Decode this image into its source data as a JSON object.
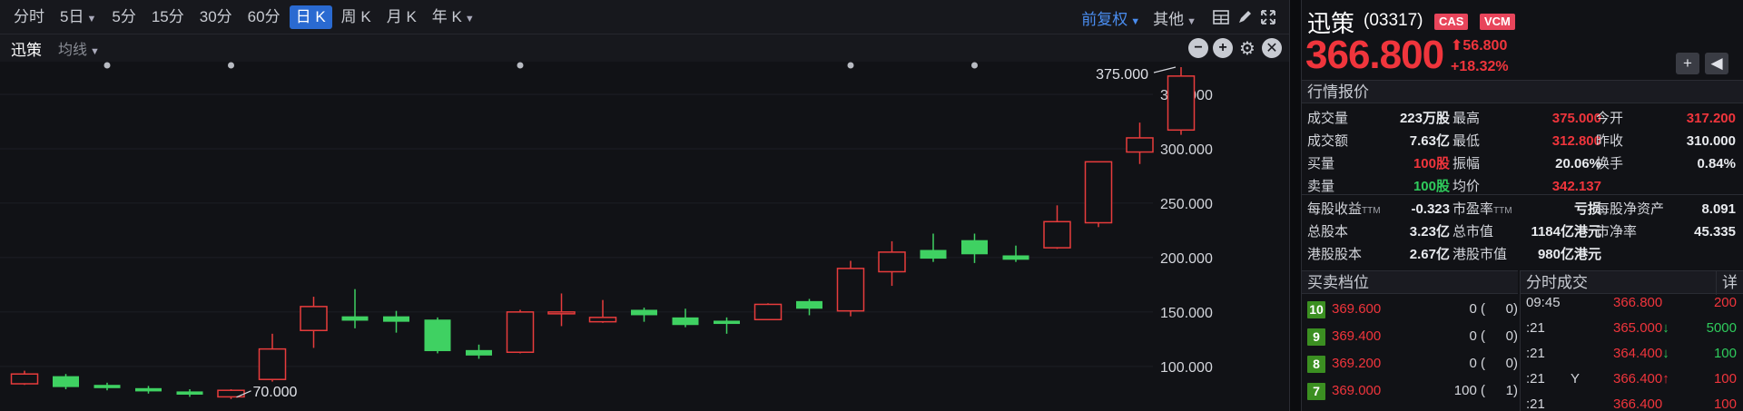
{
  "toolbar": {
    "periods": [
      {
        "label": "分时",
        "caret": false,
        "active": false
      },
      {
        "label": "5日",
        "caret": true,
        "active": false
      },
      {
        "label": "5分",
        "caret": false,
        "active": false
      },
      {
        "label": "15分",
        "caret": false,
        "active": false
      },
      {
        "label": "30分",
        "caret": false,
        "active": false
      },
      {
        "label": "60分",
        "caret": false,
        "active": false
      },
      {
        "label": "日 K",
        "caret": false,
        "active": true
      },
      {
        "label": "周 K",
        "caret": false,
        "active": false
      },
      {
        "label": "月 K",
        "caret": false,
        "active": false
      },
      {
        "label": "年 K",
        "caret": true,
        "active": false
      }
    ],
    "adjust_label": "前复权",
    "other_label": "其他"
  },
  "chart_header": {
    "name": "迅策",
    "ma_label": "均线"
  },
  "chart_data": {
    "type": "candlestick",
    "y_ticks": [
      "100.000",
      "150.000",
      "200.000",
      "250.000",
      "300.000",
      "350.000"
    ],
    "ylim": [
      64,
      380
    ],
    "up_color": "#e83c3c",
    "down_color": "#3fd162",
    "max_label": "375.000",
    "min_label": "70.000",
    "marker_candles": [
      2,
      5,
      12,
      20,
      23
    ],
    "candles": [
      {
        "o": 84,
        "c": 93,
        "h": 96,
        "l": 83
      },
      {
        "o": 91,
        "c": 81,
        "h": 93,
        "l": 79
      },
      {
        "o": 83,
        "c": 80,
        "h": 85,
        "l": 78
      },
      {
        "o": 80,
        "c": 77,
        "h": 82,
        "l": 75
      },
      {
        "o": 77,
        "c": 74,
        "h": 79,
        "l": 72
      },
      {
        "o": 72,
        "c": 78,
        "h": 79,
        "l": 70
      },
      {
        "o": 88,
        "c": 116,
        "h": 130,
        "l": 86
      },
      {
        "o": 133,
        "c": 155,
        "h": 164,
        "l": 117
      },
      {
        "o": 146,
        "c": 142,
        "h": 171,
        "l": 135
      },
      {
        "o": 146,
        "c": 141,
        "h": 151,
        "l": 131
      },
      {
        "o": 143,
        "c": 114,
        "h": 145,
        "l": 112
      },
      {
        "o": 115,
        "c": 110,
        "h": 120,
        "l": 107
      },
      {
        "o": 113,
        "c": 150,
        "h": 152,
        "l": 112
      },
      {
        "o": 150,
        "c": 150,
        "h": 167,
        "l": 137
      },
      {
        "o": 141,
        "c": 145,
        "h": 161,
        "l": 140
      },
      {
        "o": 152,
        "c": 147,
        "h": 154,
        "l": 141
      },
      {
        "o": 145,
        "c": 138,
        "h": 153,
        "l": 136
      },
      {
        "o": 142,
        "c": 139,
        "h": 145,
        "l": 130
      },
      {
        "o": 143,
        "c": 157,
        "h": 158,
        "l": 143
      },
      {
        "o": 160,
        "c": 153,
        "h": 162,
        "l": 147
      },
      {
        "o": 151,
        "c": 190,
        "h": 197,
        "l": 146
      },
      {
        "o": 187,
        "c": 205,
        "h": 215,
        "l": 174
      },
      {
        "o": 207,
        "c": 199,
        "h": 222,
        "l": 196
      },
      {
        "o": 216,
        "c": 203,
        "h": 222,
        "l": 195
      },
      {
        "o": 202,
        "c": 198,
        "h": 211,
        "l": 196
      },
      {
        "o": 209,
        "c": 233,
        "h": 248,
        "l": 208
      },
      {
        "o": 232,
        "c": 288,
        "h": 288,
        "l": 228
      },
      {
        "o": 297,
        "c": 310,
        "h": 324,
        "l": 286
      },
      {
        "o": 317.2,
        "c": 366.8,
        "h": 375,
        "l": 312.8
      }
    ]
  },
  "stock": {
    "name": "迅策",
    "code": "(03317)",
    "badges": [
      "CAS",
      "VCM"
    ],
    "price": "366.800",
    "change": "56.800",
    "change_pct": "+18.32%"
  },
  "quote": {
    "title": "行情报价",
    "rows": [
      [
        {
          "label": "成交量",
          "value": "223万股",
          "color": ""
        },
        {
          "label": "最高",
          "value": "375.000",
          "color": "red"
        },
        {
          "label": "今开",
          "value": "317.200",
          "color": "red"
        }
      ],
      [
        {
          "label": "成交额",
          "value": "7.63亿",
          "color": ""
        },
        {
          "label": "最低",
          "value": "312.800",
          "color": "red"
        },
        {
          "label": "昨收",
          "value": "310.000",
          "color": ""
        }
      ],
      [
        {
          "label": "买量",
          "value": "100股",
          "color": "red"
        },
        {
          "label": "振幅",
          "value": "20.06%",
          "color": ""
        },
        {
          "label": "换手",
          "value": "0.84%",
          "color": ""
        }
      ],
      [
        {
          "label": "卖量",
          "value": "100股",
          "color": "green"
        },
        {
          "label": "均价",
          "value": "342.137",
          "color": "red"
        }
      ]
    ],
    "rows2": [
      [
        {
          "label": "每股收益",
          "sub": "TTM",
          "value": "-0.323"
        },
        {
          "label": "市盈率",
          "sub": "TTM",
          "value": "亏损"
        },
        {
          "label": "每股净资产",
          "sub": "",
          "value": "8.091"
        }
      ],
      [
        {
          "label": "总股本",
          "sub": "",
          "value": "3.23亿"
        },
        {
          "label": "总市值",
          "sub": "",
          "value": "1184亿港元"
        },
        {
          "label": "市净率",
          "sub": "",
          "value": "45.335"
        }
      ],
      [
        {
          "label": "港股股本",
          "sub": "",
          "value": "2.67亿"
        },
        {
          "label": "港股市值",
          "sub": "",
          "value": "980亿港元"
        }
      ]
    ]
  },
  "orderbook": {
    "title": "买卖档位",
    "levels": [
      {
        "level": "10",
        "price": "369.600",
        "vol": "0 (",
        "cnt": "0)"
      },
      {
        "level": "9",
        "price": "369.400",
        "vol": "0 (",
        "cnt": "0)"
      },
      {
        "level": "8",
        "price": "369.200",
        "vol": "0 (",
        "cnt": "0)"
      },
      {
        "level": "7",
        "price": "369.000",
        "vol": "100 (",
        "cnt": "1)"
      }
    ]
  },
  "trades": {
    "title": "分时成交",
    "detail_label": "详",
    "rows": [
      {
        "time": "09:45",
        "flag": "",
        "price": "366.800",
        "arrow": "",
        "vol": "200",
        "vcolor": "red"
      },
      {
        "time": ":21",
        "flag": "",
        "price": "365.000",
        "arrow": "down",
        "vol": "5000",
        "vcolor": "green"
      },
      {
        "time": ":21",
        "flag": "",
        "price": "364.400",
        "arrow": "down",
        "vol": "100",
        "vcolor": "green"
      },
      {
        "time": ":21",
        "flag": "Y",
        "price": "366.400",
        "arrow": "up",
        "vol": "100",
        "vcolor": "red"
      },
      {
        "time": ":21",
        "flag": "",
        "price": "366.400",
        "arrow": "",
        "vol": "100",
        "vcolor": "red"
      }
    ]
  }
}
